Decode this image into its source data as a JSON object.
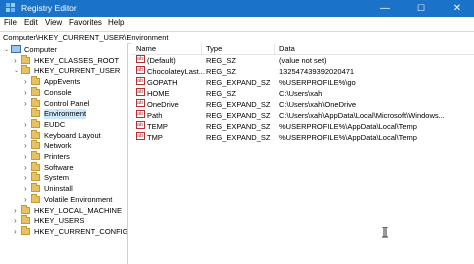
{
  "window": {
    "title": "Registry Editor",
    "minimize": "—",
    "maximize": "☐",
    "close": "✕"
  },
  "menu": [
    "File",
    "Edit",
    "View",
    "Favorites",
    "Help"
  ],
  "address": "Computer\\HKEY_CURRENT_USER\\Environment",
  "tree": [
    {
      "label": "Computer",
      "level": 0,
      "expanded": true,
      "type": "computer"
    },
    {
      "label": "HKEY_CLASSES_ROOT",
      "level": 1,
      "expanded": false
    },
    {
      "label": "HKEY_CURRENT_USER",
      "level": 1,
      "expanded": true
    },
    {
      "label": "AppEvents",
      "level": 2,
      "expanded": false
    },
    {
      "label": "Console",
      "level": 2,
      "expanded": false
    },
    {
      "label": "Control Panel",
      "level": 2,
      "expanded": false
    },
    {
      "label": "Environment",
      "level": 2,
      "expanded": false,
      "selected": true,
      "leaf": true
    },
    {
      "label": "EUDC",
      "level": 2,
      "expanded": false
    },
    {
      "label": "Keyboard Layout",
      "level": 2,
      "expanded": false
    },
    {
      "label": "Network",
      "level": 2,
      "expanded": false
    },
    {
      "label": "Printers",
      "level": 2,
      "expanded": false
    },
    {
      "label": "Software",
      "level": 2,
      "expanded": false
    },
    {
      "label": "System",
      "level": 2,
      "expanded": false
    },
    {
      "label": "Uninstall",
      "level": 2,
      "expanded": false
    },
    {
      "label": "Volatile Environment",
      "level": 2,
      "expanded": false
    },
    {
      "label": "HKEY_LOCAL_MACHINE",
      "level": 1,
      "expanded": false
    },
    {
      "label": "HKEY_USERS",
      "level": 1,
      "expanded": false
    },
    {
      "label": "HKEY_CURRENT_CONFIG",
      "level": 1,
      "expanded": false
    }
  ],
  "columns": [
    "Name",
    "Type",
    "Data"
  ],
  "values": [
    {
      "name": "(Default)",
      "type": "REG_SZ",
      "data": "(value not set)"
    },
    {
      "name": "ChocolateyLast...",
      "type": "REG_SZ",
      "data": "132547439392020471"
    },
    {
      "name": "GOPATH",
      "type": "REG_EXPAND_SZ",
      "data": "%USERPROFILE%\\go"
    },
    {
      "name": "HOME",
      "type": "REG_SZ",
      "data": "C:\\Users\\xah"
    },
    {
      "name": "OneDrive",
      "type": "REG_EXPAND_SZ",
      "data": "C:\\Users\\xah\\OneDrive"
    },
    {
      "name": "Path",
      "type": "REG_EXPAND_SZ",
      "data": "C:\\Users\\xah\\AppData\\Local\\Microsoft\\Windows..."
    },
    {
      "name": "TEMP",
      "type": "REG_EXPAND_SZ",
      "data": "%USERPROFILE%\\AppData\\Local\\Temp"
    },
    {
      "name": "TMP",
      "type": "REG_EXPAND_SZ",
      "data": "%USERPROFILE%\\AppData\\Local\\Temp"
    }
  ],
  "colors": {
    "titlebar": "#1a73c8",
    "selection": "#cce8ff",
    "folder": "#e9c062",
    "value_icon": "#b53030"
  }
}
